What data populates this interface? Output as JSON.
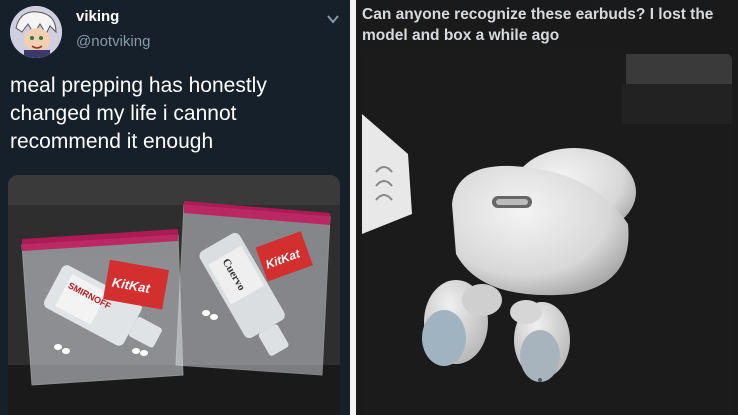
{
  "tweet": {
    "display_name": "viking",
    "handle": "@notviking",
    "text": "meal prepping has honestly changed my life i cannot recommend it enough",
    "photo": {
      "bag1_brand": "SMIRNOFF",
      "bag1_snack": "KitKat",
      "bag2_brand": "Cuervo",
      "bag2_snack": "KitKat"
    }
  },
  "post": {
    "title": "Can anyone recognize these earbuds? I lost the model and box a while ago"
  },
  "icons": {
    "chevron": "chevron-down-icon",
    "avatar": "cartoon-avatar"
  },
  "colors": {
    "tweet_bg": "#15202b",
    "post_bg": "#1a1a1b",
    "handle_gray": "#8899a6",
    "bag_seal": "#c2185b"
  }
}
